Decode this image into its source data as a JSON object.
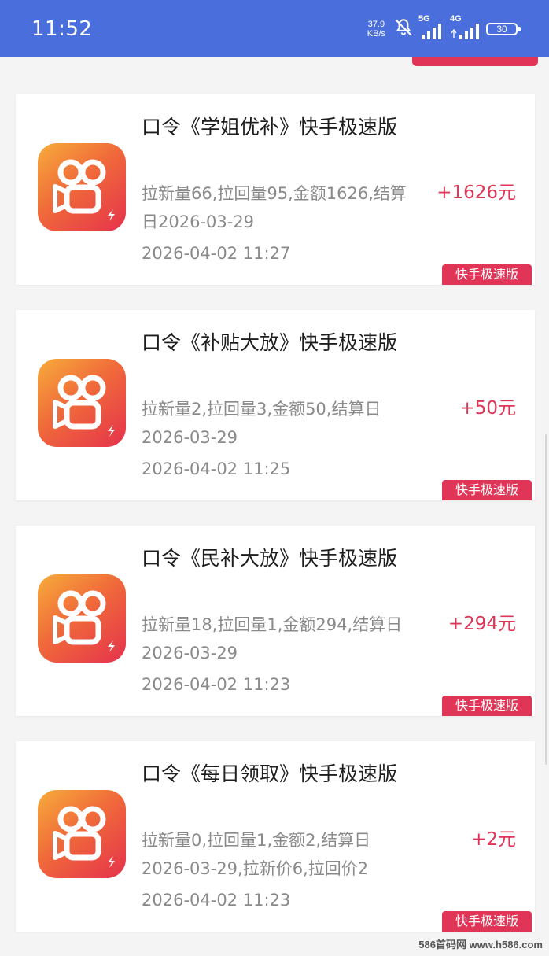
{
  "status_bar": {
    "time": "11:52",
    "net_speed_value": "37.9",
    "net_speed_unit": "KB/s",
    "signal1_label": "5G",
    "signal2_label": "4G",
    "battery": "30"
  },
  "records": [
    {
      "title": "口令《学姐优补》快手极速版",
      "detail": "拉新量66,拉回量95,金额1626,结算日2026-03-29",
      "time": "2026-04-02 11:27",
      "amount": "+1626元",
      "tag": "快手极速版",
      "icon": "kuaishou-app-icon"
    },
    {
      "title": "口令《补贴大放》快手极速版",
      "detail": "拉新量2,拉回量3,金额50,结算日2026-03-29",
      "time": "2026-04-02 11:25",
      "amount": "+50元",
      "tag": "快手极速版",
      "icon": "kuaishou-app-icon"
    },
    {
      "title": "口令《民补大放》快手极速版",
      "detail": "拉新量18,拉回量1,金额294,结算日2026-03-29",
      "time": "2026-04-02 11:23",
      "amount": "+294元",
      "tag": "快手极速版",
      "icon": "kuaishou-app-icon"
    },
    {
      "title": "口令《每日领取》快手极速版",
      "detail": "拉新量0,拉回量1,金额2,结算日2026-03-29,拉新价6,拉回价2",
      "time": "2026-04-02 11:23",
      "amount": "+2元",
      "tag": "快手极速版",
      "icon": "kuaishou-app-icon"
    }
  ],
  "watermark": "586首码网 www.h586.com",
  "colors": {
    "status_bar": "#4a6fdc",
    "accent": "#e03557",
    "logo_gradient_start": "#f7ac3b",
    "logo_gradient_end": "#e5324c"
  }
}
